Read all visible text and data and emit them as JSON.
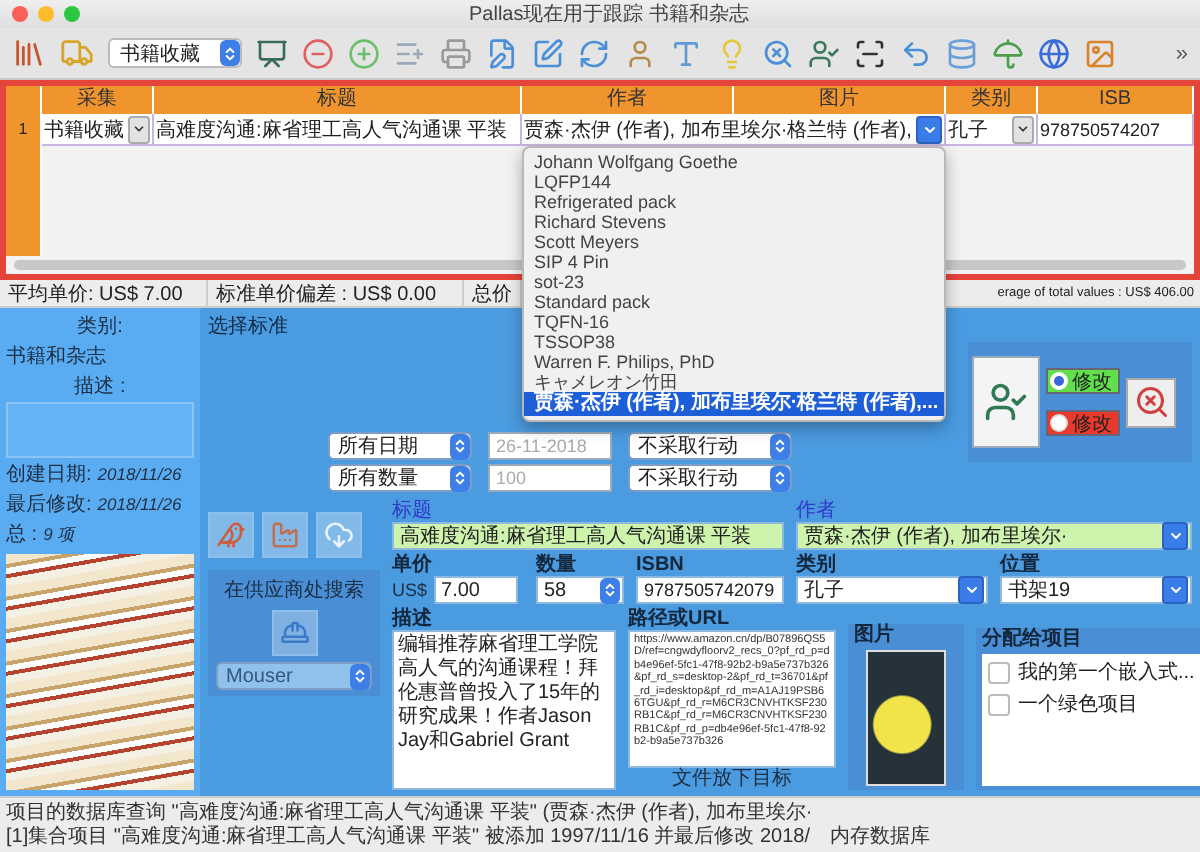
{
  "window": {
    "title": "Pallas现在用于跟踪 书籍和杂志"
  },
  "toolbar": {
    "collection": "书籍收藏",
    "overflow": "»"
  },
  "grid": {
    "columns": [
      "采集",
      "标题",
      "作者",
      "图片",
      "类别",
      "ISB"
    ],
    "rows": [
      {
        "number": "1",
        "collection": "书籍收藏",
        "title": "高难度沟通:麻省理工高人气沟通课 平装",
        "author": "贾森·杰伊 (作者), 加布里埃尔·格兰特 (作者),",
        "category": "孔子",
        "isbn": "978750574207"
      }
    ]
  },
  "author_menu": [
    {
      "label": "Johann Wolfgang Goethe",
      "selected": false
    },
    {
      "label": "LQFP144",
      "selected": false
    },
    {
      "label": "Refrigerated pack",
      "selected": false
    },
    {
      "label": "Richard Stevens",
      "selected": false
    },
    {
      "label": "Scott Meyers",
      "selected": false
    },
    {
      "label": "SIP 4 Pin",
      "selected": false
    },
    {
      "label": "sot-23",
      "selected": false
    },
    {
      "label": "Standard pack",
      "selected": false
    },
    {
      "label": "TQFN-16",
      "selected": false
    },
    {
      "label": "TSSOP38",
      "selected": false
    },
    {
      "label": "Warren F. Philips, PhD",
      "selected": false
    },
    {
      "label": "キャメレオン竹田",
      "selected": false
    },
    {
      "label": "贾森·杰伊 (作者), 加布里埃尔·格兰特 (作者),...",
      "selected": true
    }
  ],
  "status_bar": [
    "平均单价: US$ 7.00",
    "标准单价偏差 : US$ 0.00",
    "总价",
    "erage of total values : US$ 406.00"
  ],
  "sidebar": {
    "category_label": "类别:",
    "category": "书籍和杂志",
    "description_label": "描述 :",
    "created_label": "创建日期:",
    "created": "2018/11/26",
    "modified_label": "最后修改:",
    "modified": "2018/11/26",
    "total_label": "总 :",
    "total": "9 项"
  },
  "criteria": {
    "title": "选择标准",
    "filters": [
      {
        "mode": "所有日期",
        "value": "26-11-2018",
        "disabled": true,
        "action": "不采取行动"
      },
      {
        "mode": "所有数量",
        "value": "100",
        "disabled": true,
        "action": "不采取行动"
      }
    ],
    "radios": [
      {
        "label": "修改",
        "selected": true,
        "color": "#62e04c"
      },
      {
        "label": "修改",
        "selected": false,
        "color": "#e8392c"
      }
    ]
  },
  "vendor": {
    "title": "在供应商处搜索",
    "supplier": "Mouser"
  },
  "fields": {
    "title": {
      "label": "标题",
      "value": "高难度沟通:麻省理工高人气沟通课 平装"
    },
    "author": {
      "label": "作者",
      "value": "贾森·杰伊 (作者), 加布里埃尔·"
    },
    "price": {
      "label": "单价",
      "currency": "US$",
      "value": "7.00"
    },
    "quantity": {
      "label": "数量",
      "value": "58"
    },
    "isbn": {
      "label": "ISBN",
      "value": "9787505742079"
    },
    "category": {
      "label": "类别",
      "value": "孔子"
    },
    "location": {
      "label": "位置",
      "value": "书架19"
    },
    "description": {
      "label": "描述",
      "value": "编辑推荐麻省理工学院高人气的沟通课程！拜伦惠普曾投入了15年的研究成果！作者Jason Jay和Gabriel Grant"
    },
    "url": {
      "label": "路径或URL",
      "value": "https://www.amazon.cn/dp/B07896QS5D/ref=cngwdyfloorv2_recs_0?pf_rd_p=db4e96ef-5fc1-47f8-92b2-b9a5e737b326&pf_rd_s=desktop-2&pf_rd_t=36701&pf_rd_i=desktop&pf_rd_m=A1AJ19PSB66TGU&pf_rd_r=M6CR3CNVHTKSF230RB1C&pf_rd_r=M6CR3CNVHTKSF230RB1C&pf_rd_p=db4e96ef-5fc1-47f8-92b2-b9a5e737b326",
      "hint": "文件放下目标"
    },
    "image": {
      "label": "图片"
    },
    "projects": {
      "label": "分配给项目",
      "items": [
        {
          "label": "我的第一个嵌入式...",
          "checked": false
        },
        {
          "label": "一个绿色项目",
          "checked": false
        }
      ]
    }
  },
  "bottom_status": [
    "项目的数据库查询 \"高难度沟通:麻省理工高人气沟通课 平装\" (贾森·杰伊 (作者), 加布里埃尔·",
    "[1]集合项目 \"高难度沟通:麻省理工高人气沟通课 平装\" 被添加 1997/11/16 并最后修改 2018/",
    "内存数据库"
  ]
}
